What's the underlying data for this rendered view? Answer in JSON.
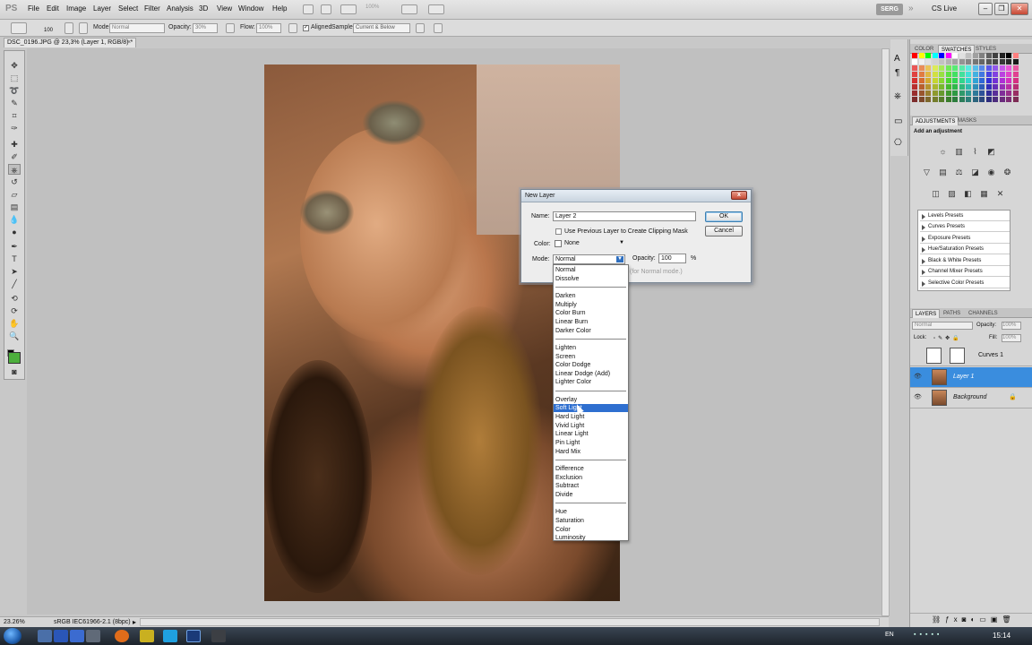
{
  "app": {
    "logo": "PS"
  },
  "menu": [
    "File",
    "Edit",
    "Image",
    "Layer",
    "Select",
    "Filter",
    "Analysis",
    "3D",
    "View",
    "Window",
    "Help"
  ],
  "workspace": {
    "user": "SERG",
    "cs_live": "CS Live"
  },
  "zoom_field": "100%",
  "options_bar": {
    "brush_size": "100",
    "mode_label": "Mode:",
    "mode_value": "Normal",
    "opacity_label": "Opacity:",
    "opacity_value": "30%",
    "flow_label": "Flow:",
    "flow_value": "100%",
    "aligned_label": "Aligned",
    "sample_label": "Sample:",
    "sample_value": "Current & Below"
  },
  "document_tab": {
    "title": "DSC_0196.JPG @ 23,3% (Layer 1, RGB/8) *",
    "close": "×"
  },
  "status_bar": {
    "zoom": "23.26%",
    "profile": "sRGB IEC61966-2.1 (8bpc)"
  },
  "panels": {
    "color_tabs": [
      "COLOR",
      "SWATCHES",
      "STYLES"
    ],
    "active_color_tab": "SWATCHES",
    "adjust_tabs": [
      "ADJUSTMENTS",
      "MASKS"
    ],
    "adjust_hint": "Add an adjustment",
    "presets": [
      "Levels Presets",
      "Curves Presets",
      "Exposure Presets",
      "Hue/Saturation Presets",
      "Black & White Presets",
      "Channel Mixer Presets",
      "Selective Color Presets"
    ],
    "layer_tabs": [
      "LAYERS",
      "PATHS",
      "CHANNELS"
    ],
    "blend_mode": "Normal",
    "opacity_label": "Opacity:",
    "opacity_value": "100%",
    "lock_label": "Lock:",
    "fill_label": "Fill:",
    "fill_value": "100%",
    "layers": [
      {
        "name": "Curves 1",
        "selected": false
      },
      {
        "name": "Layer 1",
        "selected": true
      },
      {
        "name": "Background",
        "selected": false
      }
    ]
  },
  "dialog": {
    "title": "New Layer",
    "close": "x",
    "name_label": "Name:",
    "name_value": "Layer 2",
    "clip_label": "Use Previous Layer to Create Clipping Mask",
    "color_label": "Color:",
    "color_value": "None",
    "mode_label": "Mode:",
    "mode_value": "Normal",
    "opacity_label": "Opacity:",
    "opacity_value": "100",
    "opacity_unit": "%",
    "neutral_hint": "(for Normal mode.)",
    "ok": "OK",
    "cancel": "Cancel"
  },
  "blend_modes": {
    "groups": [
      [
        "Normal",
        "Dissolve"
      ],
      [
        "Darken",
        "Multiply",
        "Color Burn",
        "Linear Burn",
        "Darker Color"
      ],
      [
        "Lighten",
        "Screen",
        "Color Dodge",
        "Linear Dodge (Add)",
        "Lighter Color"
      ],
      [
        "Overlay",
        "Soft Light",
        "Hard Light",
        "Vivid Light",
        "Linear Light",
        "Pin Light",
        "Hard Mix"
      ],
      [
        "Difference",
        "Exclusion",
        "Subtract",
        "Divide"
      ],
      [
        "Hue",
        "Saturation",
        "Color",
        "Luminosity"
      ]
    ],
    "highlighted": "Soft Light"
  },
  "taskbar": {
    "lang": "EN",
    "time": "15:14"
  },
  "colors": {
    "selection": "#2e6fd0",
    "layer_selected": "#3a8dde",
    "foreground": "#4caf3c"
  }
}
